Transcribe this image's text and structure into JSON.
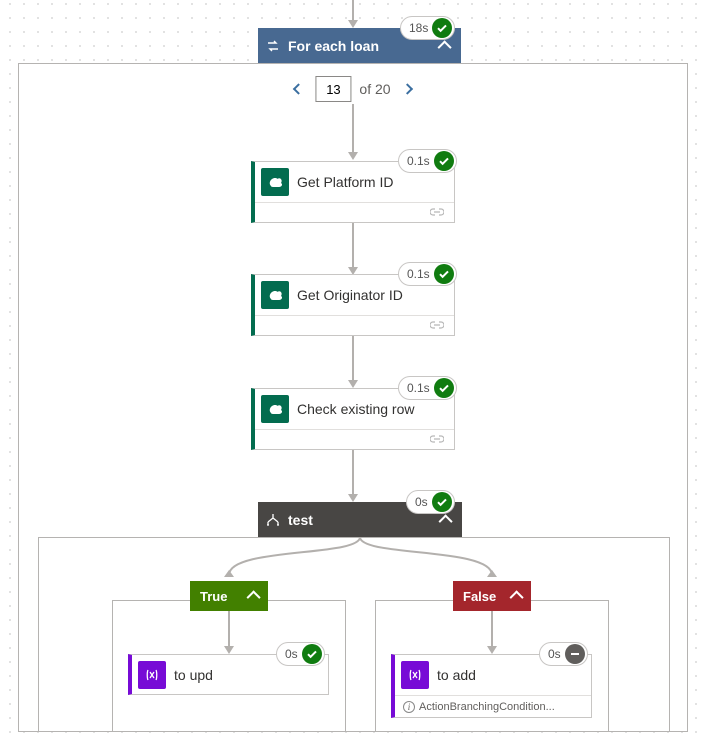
{
  "foreach": {
    "title": "For each loan",
    "badge_time": "18s"
  },
  "pager": {
    "current": "13",
    "of_label": "of 20"
  },
  "actions": [
    {
      "title": "Get Platform ID",
      "badge_time": "0.1s"
    },
    {
      "title": "Get Originator ID",
      "badge_time": "0.1s"
    },
    {
      "title": "Check existing row",
      "badge_time": "0.1s"
    }
  ],
  "condition": {
    "title": "test",
    "badge_time": "0s"
  },
  "branches": {
    "true_label": "True",
    "false_label": "False"
  },
  "true_branch": {
    "action_title": "to upd",
    "badge_time": "0s"
  },
  "false_branch": {
    "action_title": "to add",
    "badge_time": "0s",
    "footer_text": "ActionBranchingCondition..."
  }
}
